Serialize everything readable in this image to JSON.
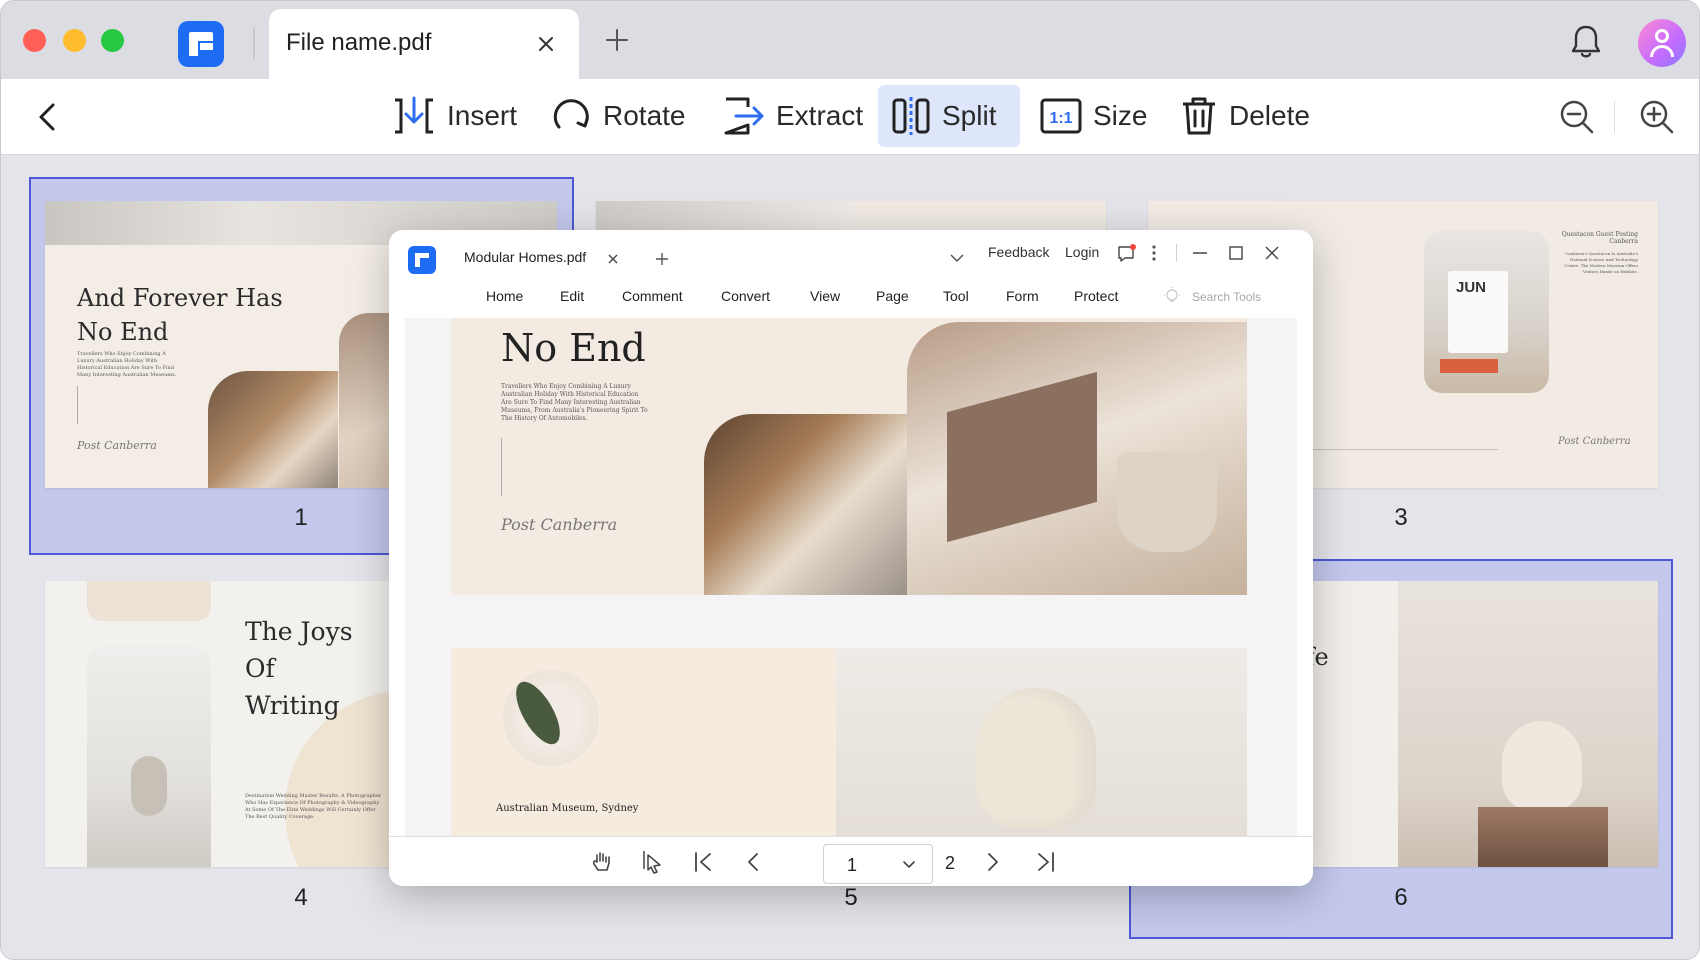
{
  "titlebar": {
    "file_tab_name": "File name.pdf"
  },
  "toolbar": {
    "insert_label": "Insert",
    "rotate_label": "Rotate",
    "extract_label": "Extract",
    "split_label": "Split",
    "size_label": "Size",
    "delete_label": "Delete"
  },
  "pages": {
    "labels": [
      "1",
      "3",
      "4",
      "5",
      "6"
    ],
    "page1_title_line1": "And Forever Has",
    "page1_title_line2": "No End",
    "page1_signature": "Post Canberra",
    "page3_month": "JUN",
    "page3_signature": "Post Canberra",
    "page3_heading_line1": "Questacon Guest Posting",
    "page3_heading_line2": "Canberra",
    "page4_title_line1": "The Joys",
    "page4_title_line2": "Of",
    "page4_title_line3": "Writing",
    "page6_partial_title": "ife"
  },
  "overlay": {
    "tab_name": "Modular Homes.pdf",
    "feedback_label": "Feedback",
    "login_label": "Login",
    "menu": [
      "Home",
      "Edit",
      "Comment",
      "Convert",
      "View",
      "Page",
      "Tool",
      "Form",
      "Protect"
    ],
    "search_placeholder": "Search Tools",
    "doc_title": "No End",
    "doc_body": "Travellers Who Enjoy Combining A Luxury Australian Holiday With Historical Education Are Sure To Find Many Interesting Australian Museums, From Australia's Pioneering Spirit To The History Of Automobiles.",
    "doc_signature": "Post Canberra",
    "page2_caption": "Australian Museum, Sydney",
    "current_page": "1",
    "total_pages": "2"
  }
}
